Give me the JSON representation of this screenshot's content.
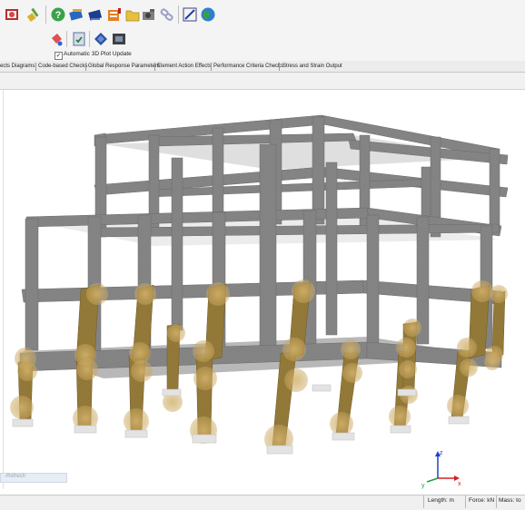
{
  "option": {
    "auto_plot_label": "Automatic 3D Plot Update",
    "auto_plot_checked": true
  },
  "tabs": [
    "ects Diagrams",
    "Code-based Checks",
    "Global Response Parameters",
    "Element Action Effects",
    "Performance Criteria Checks",
    "Stress and Strain Output"
  ],
  "status": {
    "length": "Length: m",
    "force": "Force: kN",
    "mass": "Mass: to"
  },
  "mini_panel": {
    "label": "-Refresh"
  },
  "axes": {
    "z": "z",
    "x": "x",
    "y": "y"
  },
  "icons_row1": [
    "wrench-frame-icon",
    "brush-icon",
    "help-icon",
    "book-blue-icon",
    "book-dark-icon",
    "flag-table-icon",
    "folder-icon",
    "camera-icon",
    "link-icon",
    "edit-icon",
    "globe-icon"
  ],
  "icons_row2": [
    "paint-bucket-icon",
    "clipboard-check-icon",
    "diamond-icon",
    "film-icon"
  ],
  "colors": {
    "beam": "#7c7c7c",
    "column_plastic": "#9a8240",
    "hinge": "#d8b468",
    "slab": "#bdbdbd",
    "footing": "#e2e2e2"
  }
}
